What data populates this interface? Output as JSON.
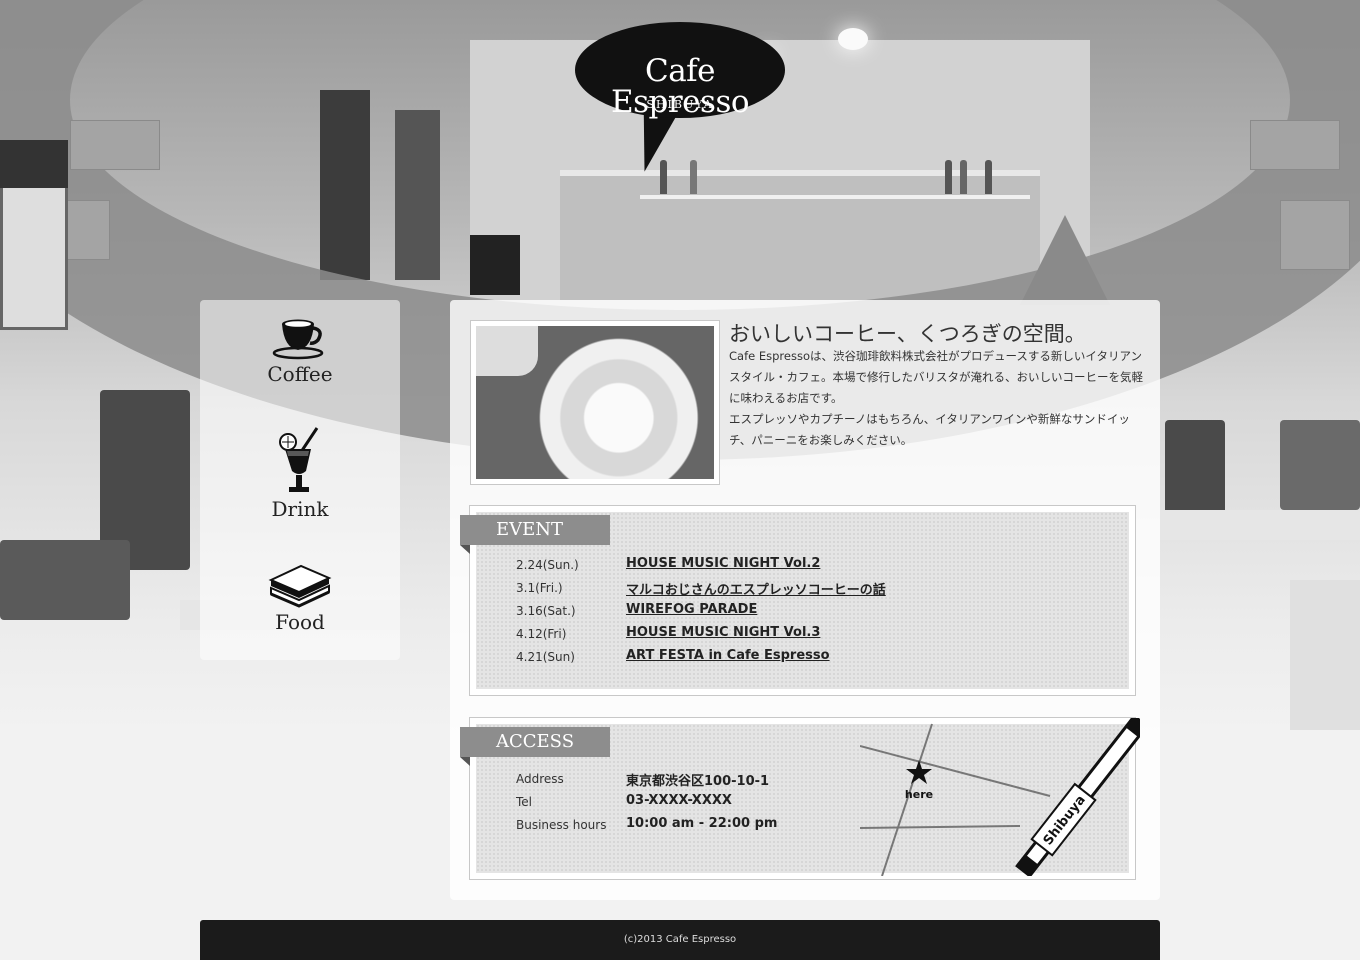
{
  "logo": {
    "title": "Cafe Espresso",
    "subtitle": "SHIBUYA"
  },
  "nav": {
    "items": [
      {
        "label": "Coffee",
        "icon": "coffee-cup-icon"
      },
      {
        "label": "Drink",
        "icon": "juice-glass-icon"
      },
      {
        "label": "Food",
        "icon": "sandwich-icon"
      }
    ]
  },
  "intro": {
    "title": "おいしいコーヒー、くつろぎの空間。",
    "text": "Cafe Espressoは、渋谷珈琲飲料株式会社がプロデュースする新しいイタリアンスタイル・カフェ。本場で修行したバリスタが淹れる、おいしいコーヒーを気軽に味わえるお店です。\nエスプレッソやカプチーノはもちろん、イタリアンワインや新鮮なサンドイッチ、パニーニをお楽しみください。"
  },
  "event": {
    "heading": "EVENT",
    "items": [
      {
        "date": "2.24(Sun.)",
        "title": "HOUSE MUSIC NIGHT Vol.2"
      },
      {
        "date": "3.1(Fri.)",
        "title": "マルコおじさんのエスプレッソコーヒーの話"
      },
      {
        "date": "3.16(Sat.)",
        "title": "WIREFOG PARADE"
      },
      {
        "date": "4.12(Fri)",
        "title": "HOUSE MUSIC NIGHT Vol.3"
      },
      {
        "date": "4.21(Sun)",
        "title": "ART FESTA in Cafe Espresso"
      }
    ]
  },
  "access": {
    "heading": "ACCESS",
    "rows": [
      {
        "label": "Address",
        "value": "東京都渋谷区100-10-1"
      },
      {
        "label": "Tel",
        "value": "03-XXXX-XXXX"
      },
      {
        "label": "Business hours",
        "value": "10:00 am - 22:00 pm"
      }
    ],
    "map": {
      "marker_label": "here",
      "station_label": "Shibuya"
    }
  },
  "footer": {
    "copyright": "(c)2013 Cafe Espresso"
  }
}
